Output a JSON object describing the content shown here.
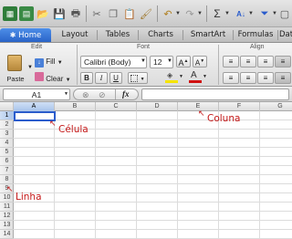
{
  "toolbar": {
    "icons": [
      "new-workbook-icon",
      "template-gallery-icon",
      "open-icon",
      "save-icon",
      "print-icon",
      "cut-icon",
      "copy-icon",
      "paste-icon",
      "format-painter-icon",
      "undo-icon",
      "redo-icon",
      "autosum-icon",
      "sort-icon",
      "filter-icon"
    ]
  },
  "tabs": [
    {
      "label": "Home",
      "active": true
    },
    {
      "label": "Layout"
    },
    {
      "label": "Tables"
    },
    {
      "label": "Charts"
    },
    {
      "label": "SmartArt"
    },
    {
      "label": "Formulas"
    },
    {
      "label": "Data"
    }
  ],
  "ribbon": {
    "groups": {
      "edit": "Edit",
      "font": "Font",
      "alignment": "Align"
    },
    "paste_label": "Paste",
    "fill_label": "Fill",
    "clear_label": "Clear",
    "font_name": "Calibri (Body)",
    "font_size": "12",
    "bold": "B",
    "italic": "I",
    "underline": "U",
    "grow_font": "A",
    "shrink_font": "A",
    "colors": {
      "highlight": "#f5e400",
      "font_color": "#d01010",
      "accent": "#2a64c8"
    }
  },
  "formula_bar": {
    "name_box": "A1",
    "fx": "fx",
    "formula": ""
  },
  "grid": {
    "columns": [
      "A",
      "B",
      "C",
      "D",
      "E",
      "F",
      "G"
    ],
    "rows": [
      "1",
      "2",
      "3",
      "4",
      "5",
      "6",
      "7",
      "8",
      "9",
      "10",
      "11",
      "12",
      "13",
      "14"
    ],
    "active_cell": "A1"
  },
  "annotations": {
    "cell": "Célula",
    "column": "Coluna",
    "row": "Linha"
  }
}
